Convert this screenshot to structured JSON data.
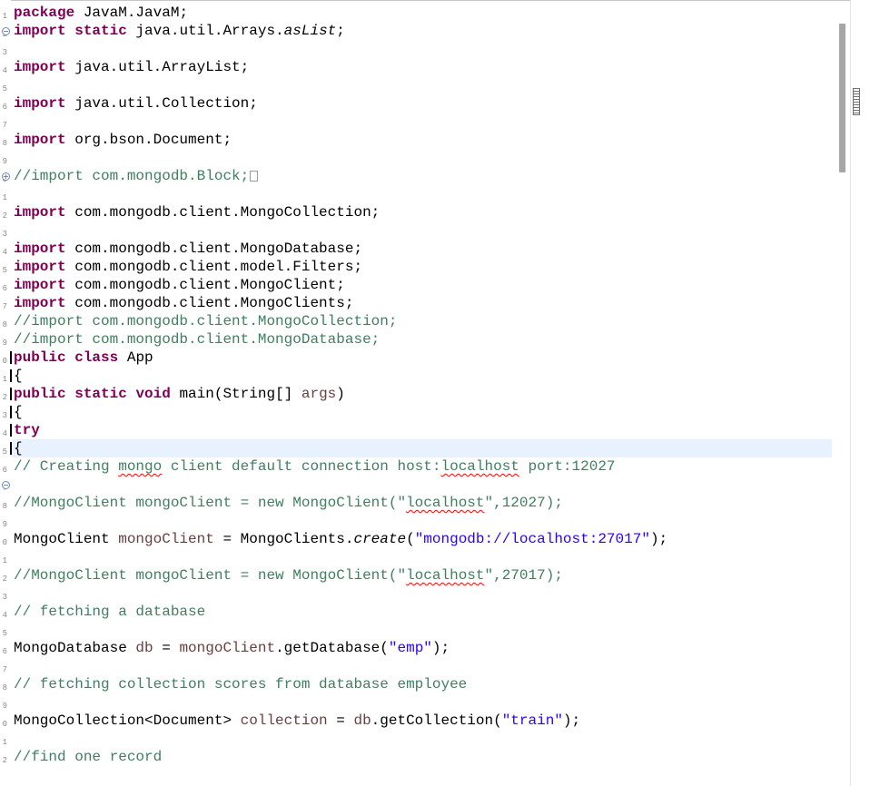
{
  "editor": {
    "language": "java",
    "current_line_index": 24,
    "lines": [
      {
        "segments": [
          {
            "t": "package",
            "c": "kw"
          },
          {
            "t": " JavaM.JavaM;",
            "c": ""
          }
        ]
      },
      {
        "fold": "minus",
        "segments": [
          {
            "t": "import",
            "c": "kw"
          },
          {
            "t": " ",
            "c": ""
          },
          {
            "t": "static",
            "c": "kw"
          },
          {
            "t": " java.util.Arrays.",
            "c": ""
          },
          {
            "t": "asList",
            "c": "static-m"
          },
          {
            "t": ";",
            "c": ""
          }
        ]
      },
      {
        "segments": []
      },
      {
        "segments": [
          {
            "t": "import",
            "c": "kw"
          },
          {
            "t": " java.util.ArrayList;",
            "c": ""
          }
        ]
      },
      {
        "segments": []
      },
      {
        "segments": [
          {
            "t": "import",
            "c": "kw"
          },
          {
            "t": " java.util.Collection;",
            "c": ""
          }
        ]
      },
      {
        "segments": []
      },
      {
        "segments": [
          {
            "t": "import",
            "c": "kw"
          },
          {
            "t": " org.bson.Document;",
            "c": ""
          }
        ]
      },
      {
        "segments": []
      },
      {
        "fold": "plus",
        "segments": [
          {
            "t": "//import com.mongodb.Block;",
            "c": "cm"
          },
          {
            "t": "",
            "c": "collapsed"
          }
        ]
      },
      {
        "segments": []
      },
      {
        "segments": [
          {
            "t": "import",
            "c": "kw"
          },
          {
            "t": " com.mongodb.client.MongoCollection;",
            "c": ""
          }
        ]
      },
      {
        "segments": []
      },
      {
        "segments": [
          {
            "t": "import",
            "c": "kw"
          },
          {
            "t": " com.mongodb.client.MongoDatabase;",
            "c": ""
          }
        ]
      },
      {
        "segments": [
          {
            "t": "import",
            "c": "kw"
          },
          {
            "t": " com.mongodb.client.model.Filters;",
            "c": ""
          }
        ]
      },
      {
        "segments": [
          {
            "t": "import",
            "c": "kw"
          },
          {
            "t": " com.mongodb.client.MongoClient;",
            "c": ""
          }
        ]
      },
      {
        "segments": [
          {
            "t": "import",
            "c": "kw"
          },
          {
            "t": " com.mongodb.client.MongoClients;",
            "c": ""
          }
        ]
      },
      {
        "segments": [
          {
            "t": "//import com.mongodb.client.MongoCollection;",
            "c": "cm"
          }
        ]
      },
      {
        "segments": [
          {
            "t": "//import com.mongodb.client.MongoDatabase;",
            "c": "cm"
          }
        ]
      },
      {
        "segments": [
          {
            "t": "public",
            "c": "kw"
          },
          {
            "t": " ",
            "c": ""
          },
          {
            "t": "class",
            "c": "kw"
          },
          {
            "t": " App",
            "c": ""
          }
        ]
      },
      {
        "segments": [
          {
            "t": "{",
            "c": ""
          }
        ]
      },
      {
        "segments": [
          {
            "t": "public",
            "c": "kw"
          },
          {
            "t": " ",
            "c": ""
          },
          {
            "t": "static",
            "c": "kw"
          },
          {
            "t": " ",
            "c": ""
          },
          {
            "t": "void",
            "c": "kw"
          },
          {
            "t": " main(String[] ",
            "c": ""
          },
          {
            "t": "args",
            "c": "var"
          },
          {
            "t": ")",
            "c": ""
          }
        ]
      },
      {
        "segments": [
          {
            "t": "{",
            "c": ""
          }
        ]
      },
      {
        "segments": [
          {
            "t": "try",
            "c": "kw"
          }
        ]
      },
      {
        "segments": [
          {
            "t": "{",
            "c": ""
          }
        ]
      },
      {
        "segments": [
          {
            "t": "// Creating ",
            "c": "cm"
          },
          {
            "t": "mongo",
            "c": "cm squig"
          },
          {
            "t": " client default connection host:",
            "c": "cm"
          },
          {
            "t": "localhost",
            "c": "cm squig"
          },
          {
            "t": " port:12027",
            "c": "cm"
          }
        ]
      },
      {
        "fold": "minus",
        "segments": []
      },
      {
        "segments": [
          {
            "t": "//MongoClient mongoClient = new MongoClient(\"",
            "c": "cm"
          },
          {
            "t": "localhost",
            "c": "cm squig"
          },
          {
            "t": "\",12027);",
            "c": "cm"
          }
        ]
      },
      {
        "segments": []
      },
      {
        "segments": [
          {
            "t": "MongoClient ",
            "c": ""
          },
          {
            "t": "mongoClient",
            "c": "var"
          },
          {
            "t": " = MongoClients.",
            "c": ""
          },
          {
            "t": "create",
            "c": "static-m"
          },
          {
            "t": "(",
            "c": ""
          },
          {
            "t": "\"mongodb://localhost:27017\"",
            "c": "str"
          },
          {
            "t": ");",
            "c": ""
          }
        ]
      },
      {
        "segments": []
      },
      {
        "segments": [
          {
            "t": "//MongoClient mongoClient = new MongoClient(\"",
            "c": "cm"
          },
          {
            "t": "localhost",
            "c": "cm squig"
          },
          {
            "t": "\",27017);",
            "c": "cm"
          }
        ]
      },
      {
        "segments": []
      },
      {
        "segments": [
          {
            "t": "// fetching a database",
            "c": "cm"
          }
        ]
      },
      {
        "segments": []
      },
      {
        "segments": [
          {
            "t": "MongoDatabase ",
            "c": ""
          },
          {
            "t": "db",
            "c": "var"
          },
          {
            "t": " = ",
            "c": ""
          },
          {
            "t": "mongoClient",
            "c": "var"
          },
          {
            "t": ".getDatabase(",
            "c": ""
          },
          {
            "t": "\"emp\"",
            "c": "str"
          },
          {
            "t": ");",
            "c": ""
          }
        ]
      },
      {
        "segments": []
      },
      {
        "segments": [
          {
            "t": "// fetching collection scores from database employee",
            "c": "cm"
          }
        ]
      },
      {
        "segments": []
      },
      {
        "segments": [
          {
            "t": "MongoCollection<Document> ",
            "c": ""
          },
          {
            "t": "collection",
            "c": "var"
          },
          {
            "t": " = ",
            "c": ""
          },
          {
            "t": "db",
            "c": "var"
          },
          {
            "t": ".getCollection(",
            "c": ""
          },
          {
            "t": "\"train\"",
            "c": "str"
          },
          {
            "t": ");",
            "c": ""
          }
        ]
      },
      {
        "segments": []
      },
      {
        "segments": [
          {
            "t": "//find one record",
            "c": "cm"
          }
        ]
      }
    ]
  },
  "gutter_digits": [
    "1",
    "2",
    "3",
    "4",
    "5",
    "6",
    "7",
    "8",
    "9",
    "0",
    "1",
    "2",
    "3",
    "4",
    "5",
    "6",
    "7",
    "8",
    "9",
    "0",
    "1",
    "2",
    "3",
    "4",
    "5",
    "6",
    "7",
    "8",
    "9",
    "0",
    "1",
    "2",
    "3",
    "4",
    "5",
    "6",
    "7",
    "8",
    "9",
    "0",
    "1",
    "2"
  ],
  "colors": {
    "keyword": "#7f0055",
    "comment": "#3f7f5f",
    "string": "#2a00ff",
    "local_variable": "#6a3e3e",
    "current_line": "#e8f2fe"
  },
  "icons": {
    "fold_expanded": "minus-circle-icon",
    "fold_collapsed": "plus-circle-icon",
    "collapsed_block": "collapsed-block-icon"
  }
}
